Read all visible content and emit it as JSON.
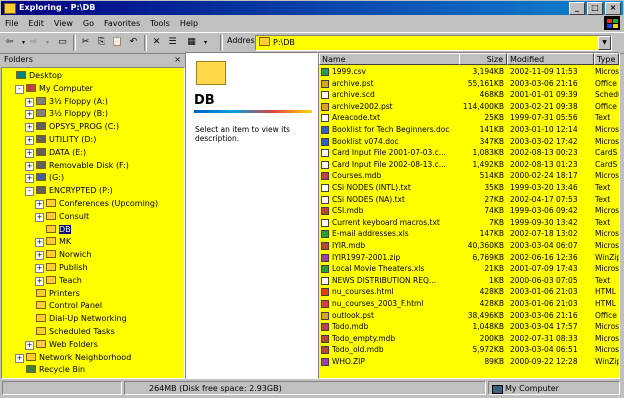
{
  "title": "Exploring - P:\\DB",
  "menu": [
    "File",
    "Edit",
    "View",
    "Go",
    "Favorites",
    "Tools",
    "Help"
  ],
  "address": {
    "label": "Address",
    "value": "P:\\DB"
  },
  "folders_header": "Folders",
  "tree": [
    {
      "label": "Desktop",
      "indent": 0,
      "pm": "",
      "icon": "desktop-icon"
    },
    {
      "label": "My Computer",
      "indent": 1,
      "pm": "-",
      "icon": "computer-icon"
    },
    {
      "label": "3½ Floppy (A:)",
      "indent": 2,
      "pm": "+",
      "icon": "floppy-icon"
    },
    {
      "label": "3½ Floppy (B:)",
      "indent": 2,
      "pm": "+",
      "icon": "floppy-icon"
    },
    {
      "label": "OPSYS_PROG (C:)",
      "indent": 2,
      "pm": "+",
      "icon": "drive-icon"
    },
    {
      "label": "UTILITY (D:)",
      "indent": 2,
      "pm": "+",
      "icon": "drive-icon"
    },
    {
      "label": "DATA (E:)",
      "indent": 2,
      "pm": "+",
      "icon": "drive-icon"
    },
    {
      "label": "Removable Disk (F:)",
      "indent": 2,
      "pm": "+",
      "icon": "drive-icon"
    },
    {
      "label": "(G:)",
      "indent": 2,
      "pm": "+",
      "icon": "cd-icon"
    },
    {
      "label": "ENCRYPTED (P:)",
      "indent": 2,
      "pm": "-",
      "icon": "drive-icon"
    },
    {
      "label": "Conferences (Upcoming)",
      "indent": 3,
      "pm": "+",
      "icon": "folder-icon"
    },
    {
      "label": "Consult",
      "indent": 3,
      "pm": "+",
      "icon": "folder-icon"
    },
    {
      "label": "DB",
      "indent": 3,
      "pm": "",
      "icon": "folder-icon",
      "selected": true
    },
    {
      "label": "MK",
      "indent": 3,
      "pm": "+",
      "icon": "folder-icon"
    },
    {
      "label": "Norwich",
      "indent": 3,
      "pm": "+",
      "icon": "folder-icon"
    },
    {
      "label": "Publish",
      "indent": 3,
      "pm": "+",
      "icon": "folder-icon"
    },
    {
      "label": "Teach",
      "indent": 3,
      "pm": "+",
      "icon": "folder-icon"
    },
    {
      "label": "Printers",
      "indent": 2,
      "pm": "",
      "icon": "printer-icon"
    },
    {
      "label": "Control Panel",
      "indent": 2,
      "pm": "",
      "icon": "control-panel-icon"
    },
    {
      "label": "Dial-Up Networking",
      "indent": 2,
      "pm": "",
      "icon": "network-icon"
    },
    {
      "label": "Scheduled Tasks",
      "indent": 2,
      "pm": "",
      "icon": "tasks-icon"
    },
    {
      "label": "Web Folders",
      "indent": 2,
      "pm": "+",
      "icon": "web-folder-icon"
    },
    {
      "label": "Network Neighborhood",
      "indent": 1,
      "pm": "+",
      "icon": "network-icon"
    },
    {
      "label": "Recycle Bin",
      "indent": 1,
      "pm": "",
      "icon": "recycle-bin-icon"
    }
  ],
  "middle": {
    "title": "DB",
    "description": "Select an item to view its description."
  },
  "columns": [
    "Name",
    "Size",
    "Modified",
    "Type"
  ],
  "files": [
    {
      "name": "1999.csv",
      "size": "3,194KB",
      "modified": "2002-11-09 11:53",
      "type": "Micros",
      "color": "#20a040"
    },
    {
      "name": "archive.pst",
      "size": "55,161KB",
      "modified": "2003-03-06 21:16",
      "type": "Office",
      "color": "#e0a020"
    },
    {
      "name": "archive.scd",
      "size": "468KB",
      "modified": "2001-01-01 09:39",
      "type": "Schedu",
      "color": "#ffffff"
    },
    {
      "name": "archive2002.pst",
      "size": "114,400KB",
      "modified": "2003-02-21 09:38",
      "type": "Office",
      "color": "#e0a020"
    },
    {
      "name": "Areacode.txt",
      "size": "25KB",
      "modified": "1999-07-31 05:56",
      "type": "Text",
      "color": "#ffffff"
    },
    {
      "name": "Booklist for Tech Beginners.doc",
      "size": "141KB",
      "modified": "2003-01-10 12:14",
      "type": "Micros",
      "color": "#3060c0"
    },
    {
      "name": "Booklist v074.doc",
      "size": "347KB",
      "modified": "2003-03-02 17:42",
      "type": "Micros",
      "color": "#3060c0"
    },
    {
      "name": "Card Input File 2001-07-03.c...",
      "size": "1,083KB",
      "modified": "2002-08-13 00:23",
      "type": "CardS",
      "color": "#ffffff"
    },
    {
      "name": "Card Input File 2002-08-13.c...",
      "size": "1,492KB",
      "modified": "2002-08-13 01:23",
      "type": "CardS",
      "color": "#ffffff"
    },
    {
      "name": "Courses.mdb",
      "size": "514KB",
      "modified": "2000-02-24 18:17",
      "type": "Micros",
      "color": "#c04040"
    },
    {
      "name": "CSi NODES (INTL).txt",
      "size": "35KB",
      "modified": "1999-03-20 13:46",
      "type": "Text",
      "color": "#ffffff"
    },
    {
      "name": "CSi NODES (NA).txt",
      "size": "27KB",
      "modified": "2002-04-17 07:53",
      "type": "Text",
      "color": "#ffffff"
    },
    {
      "name": "CSI.mdb",
      "size": "74KB",
      "modified": "1999-03-06 09:42",
      "type": "Micros",
      "color": "#c04040"
    },
    {
      "name": "Current keyboard macros.txt",
      "size": "7KB",
      "modified": "1999-09-30 13:42",
      "type": "Text",
      "color": "#ffffff"
    },
    {
      "name": "E-mail addresses.xls",
      "size": "147KB",
      "modified": "2002-07-18 13:02",
      "type": "Micros",
      "color": "#20a040"
    },
    {
      "name": "IYIR.mdb",
      "size": "40,360KB",
      "modified": "2003-03-04 06:07",
      "type": "Micros",
      "color": "#c04040"
    },
    {
      "name": "IYIR1997-2001.zip",
      "size": "6,769KB",
      "modified": "2002-06-16 12:36",
      "type": "WinZip",
      "color": "#a040a0"
    },
    {
      "name": "Local Movie Theaters.xls",
      "size": "21KB",
      "modified": "2001-07-09 17:43",
      "type": "Micros",
      "color": "#20a040"
    },
    {
      "name": "NEWS DISTRIBUTION REQ...",
      "size": "1KB",
      "modified": "2000-06-03 07:05",
      "type": "Text",
      "color": "#ffffff"
    },
    {
      "name": "nu_courses.html",
      "size": "428KB",
      "modified": "2003-01-06 21:03",
      "type": "HTML",
      "color": "#e04020"
    },
    {
      "name": "nu_courses_2003_F.html",
      "size": "428KB",
      "modified": "2003-01-06 21:03",
      "type": "HTML",
      "color": "#e04020"
    },
    {
      "name": "outlook.pst",
      "size": "38,496KB",
      "modified": "2003-03-06 21:16",
      "type": "Office",
      "color": "#e0a020"
    },
    {
      "name": "Todo.mdb",
      "size": "1,048KB",
      "modified": "2003-03-04 17:57",
      "type": "Micros",
      "color": "#c04040"
    },
    {
      "name": "Todo_empty.mdb",
      "size": "200KB",
      "modified": "2002-07-31 08:33",
      "type": "Micros",
      "color": "#c04040"
    },
    {
      "name": "Todo_old.mdb",
      "size": "5,972KB",
      "modified": "2003-03-04 06:51",
      "type": "Micros",
      "color": "#c04040"
    },
    {
      "name": "WHO.ZIP",
      "size": "89KB",
      "modified": "2000-09-22 12:28",
      "type": "WinZip",
      "color": "#a040a0"
    }
  ],
  "status": {
    "disk": "264MB (Disk free space: 2.93GB)",
    "location": "My Computer"
  }
}
